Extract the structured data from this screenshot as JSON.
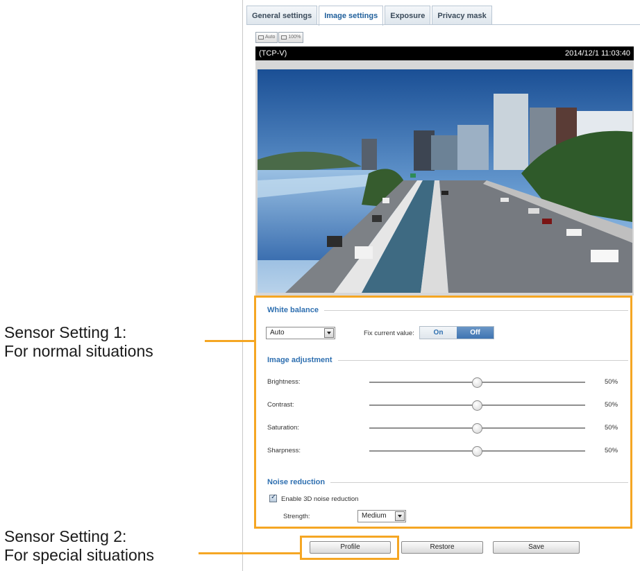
{
  "tabs": [
    {
      "label": "General settings"
    },
    {
      "label": "Image settings"
    },
    {
      "label": "Exposure"
    },
    {
      "label": "Privacy mask"
    }
  ],
  "view_modes": [
    {
      "label": "Auto"
    },
    {
      "label": "100%"
    }
  ],
  "video": {
    "stream_label": "(TCP-V)",
    "timestamp": "2014/12/1 11:03:40"
  },
  "white_balance": {
    "title": "White balance",
    "mode_value": "Auto",
    "fix_label": "Fix current value:",
    "on_label": "On",
    "off_label": "Off"
  },
  "image_adjustment": {
    "title": "Image adjustment",
    "sliders": [
      {
        "label": "Brightness:",
        "percent": "50%",
        "level": 0.5
      },
      {
        "label": "Contrast:",
        "percent": "50%",
        "level": 0.5
      },
      {
        "label": "Saturation:",
        "percent": "50%",
        "level": 0.5
      },
      {
        "label": "Sharpness:",
        "percent": "50%",
        "level": 0.5
      }
    ]
  },
  "noise_reduction": {
    "title": "Noise reduction",
    "enable_label": "Enable 3D noise reduction",
    "enabled": true,
    "strength_label": "Strength:",
    "strength_value": "Medium"
  },
  "buttons": {
    "profile": "Profile",
    "restore": "Restore",
    "save": "Save"
  },
  "callouts": {
    "setting1_line1": "Sensor Setting 1:",
    "setting1_line2": "For normal situations",
    "setting2_line1": "Sensor Setting 2:",
    "setting2_line2": "For special situations"
  },
  "colors": {
    "highlight": "#f5a623",
    "accent": "#2e6fb0"
  }
}
